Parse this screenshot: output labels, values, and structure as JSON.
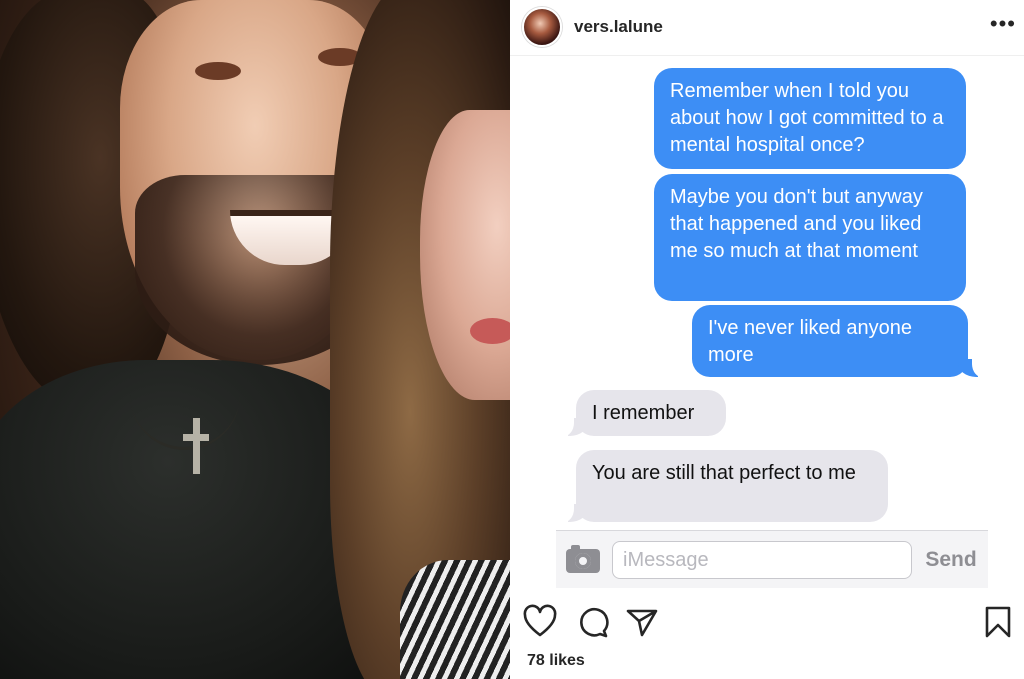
{
  "post": {
    "username": "vers.lalune",
    "more_icon": "more-horizontal-icon",
    "likes_text": "78 likes"
  },
  "chat": {
    "messages": [
      {
        "direction": "sent",
        "text": "Remember when I told you about how I got committed to a mental hospital once?"
      },
      {
        "direction": "sent",
        "text": "Maybe you don't but anyway that happened and you liked me so much at that moment"
      },
      {
        "direction": "sent",
        "text": "I've never liked anyone more"
      },
      {
        "direction": "received",
        "text": "I remember"
      },
      {
        "direction": "received",
        "text": "You are still that perfect to me"
      }
    ],
    "composer": {
      "placeholder": "iMessage",
      "send_label": "Send",
      "camera_icon": "camera-icon"
    }
  },
  "actions": {
    "icons": [
      "heart-icon",
      "comment-icon",
      "share-icon",
      "bookmark-icon"
    ]
  },
  "colors": {
    "sent_bubble": "#3d8ef5",
    "received_bubble": "#e6e5eb",
    "text_dark": "#262626"
  }
}
